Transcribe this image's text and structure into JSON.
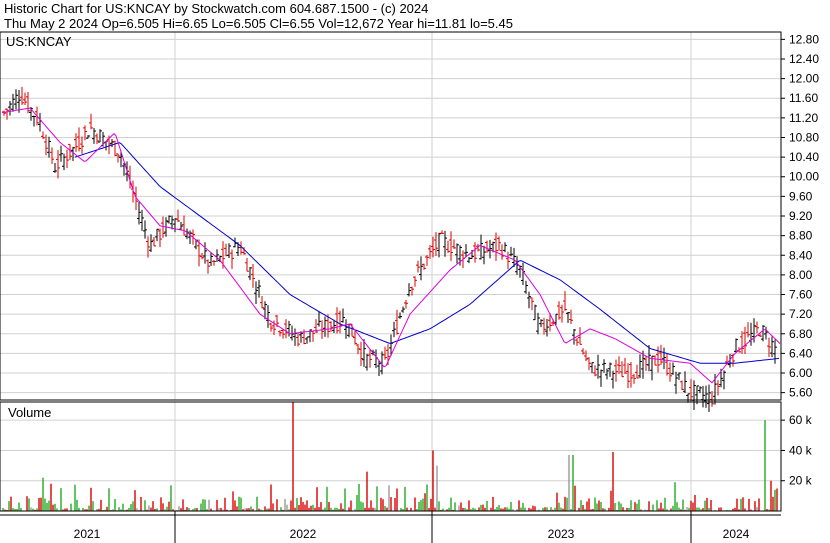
{
  "header": {
    "line1": "Historic Chart for US:KNCAY by Stockwatch.com 604.687.1500 - (c) 2024",
    "line2": "Thu May  2 2024   Op=6.505   Hi=6.65   Lo=6.505   Cl=6.55   Vol=12,672   Year hi=11.81   lo=5.45"
  },
  "chart_data": [
    {
      "type": "ohlc",
      "title": "US:KNCAY",
      "ylim": [
        5.45,
        12.95
      ],
      "y_ticks": [
        "12.80",
        "12.40",
        "12.00",
        "11.60",
        "11.20",
        "10.80",
        "10.40",
        "10.00",
        "9.60",
        "9.20",
        "8.80",
        "8.40",
        "8.00",
        "7.60",
        "7.20",
        "6.80",
        "6.40",
        "6.00",
        "5.60"
      ],
      "x_ticks": [
        "2021",
        "2022",
        "2023",
        "2024"
      ],
      "grid": true,
      "colors": {
        "up": "#000000",
        "down": "#dd0000",
        "ma_short": "#dd00dd",
        "ma_long": "#0000cc"
      },
      "price_anchors": [
        [
          0,
          11.2
        ],
        [
          20,
          11.7
        ],
        [
          40,
          11.1
        ],
        [
          55,
          10.2
        ],
        [
          75,
          10.6
        ],
        [
          90,
          11.0
        ],
        [
          120,
          10.5
        ],
        [
          150,
          8.6
        ],
        [
          175,
          9.2
        ],
        [
          210,
          8.2
        ],
        [
          240,
          8.6
        ],
        [
          270,
          7.1
        ],
        [
          300,
          6.7
        ],
        [
          320,
          6.9
        ],
        [
          345,
          7.1
        ],
        [
          365,
          6.3
        ],
        [
          385,
          6.2
        ],
        [
          410,
          7.8
        ],
        [
          440,
          8.7
        ],
        [
          470,
          8.4
        ],
        [
          500,
          8.6
        ],
        [
          520,
          8.1
        ],
        [
          540,
          6.9
        ],
        [
          565,
          7.3
        ],
        [
          590,
          6.1
        ],
        [
          630,
          6.0
        ],
        [
          660,
          6.3
        ],
        [
          690,
          5.6
        ],
        [
          712,
          5.5
        ],
        [
          735,
          6.5
        ],
        [
          760,
          6.9
        ],
        [
          775,
          6.5
        ]
      ],
      "ma_short_anchors": [
        [
          0,
          11.3
        ],
        [
          30,
          11.4
        ],
        [
          60,
          10.7
        ],
        [
          85,
          10.3
        ],
        [
          115,
          10.9
        ],
        [
          135,
          9.6
        ],
        [
          160,
          9.0
        ],
        [
          185,
          8.9
        ],
        [
          220,
          8.3
        ],
        [
          260,
          7.2
        ],
        [
          290,
          6.8
        ],
        [
          330,
          6.9
        ],
        [
          350,
          7.0
        ],
        [
          385,
          6.1
        ],
        [
          410,
          7.2
        ],
        [
          450,
          8.1
        ],
        [
          480,
          8.6
        ],
        [
          515,
          8.3
        ],
        [
          540,
          7.6
        ],
        [
          565,
          6.6
        ],
        [
          590,
          6.9
        ],
        [
          615,
          6.7
        ],
        [
          650,
          6.3
        ],
        [
          690,
          6.2
        ],
        [
          712,
          5.8
        ],
        [
          735,
          6.4
        ],
        [
          765,
          6.9
        ],
        [
          780,
          6.6
        ]
      ],
      "ma_long_anchors": [
        [
          75,
          10.4
        ],
        [
          120,
          10.7
        ],
        [
          160,
          9.8
        ],
        [
          200,
          9.2
        ],
        [
          240,
          8.6
        ],
        [
          290,
          7.6
        ],
        [
          340,
          7.0
        ],
        [
          390,
          6.6
        ],
        [
          430,
          6.9
        ],
        [
          470,
          7.4
        ],
        [
          520,
          8.3
        ],
        [
          560,
          7.9
        ],
        [
          600,
          7.3
        ],
        [
          650,
          6.5
        ],
        [
          700,
          6.2
        ],
        [
          735,
          6.2
        ],
        [
          780,
          6.3
        ]
      ]
    },
    {
      "type": "bar",
      "title": "Volume",
      "ylim": [
        0,
        72000
      ],
      "y_ticks": [
        "60 k",
        "40 k",
        "20 k"
      ],
      "colors": {
        "up": "#22aa22",
        "down": "#dd0000",
        "flat": "#999999"
      },
      "spikes": [
        [
          43,
          22000,
          "up"
        ],
        [
          50,
          18000,
          "down"
        ],
        [
          108,
          15000,
          "up"
        ],
        [
          170,
          17000,
          "up"
        ],
        [
          293,
          72000,
          "down"
        ],
        [
          367,
          26000,
          "down"
        ],
        [
          433,
          40000,
          "down"
        ],
        [
          437,
          30000,
          "flat"
        ],
        [
          569,
          37000,
          "flat"
        ],
        [
          573,
          37000,
          "up"
        ],
        [
          613,
          39000,
          "down"
        ],
        [
          674,
          19000,
          "up"
        ],
        [
          765,
          60000,
          "up"
        ],
        [
          770,
          20000,
          "down"
        ],
        [
          775,
          14000,
          "up"
        ]
      ]
    }
  ]
}
